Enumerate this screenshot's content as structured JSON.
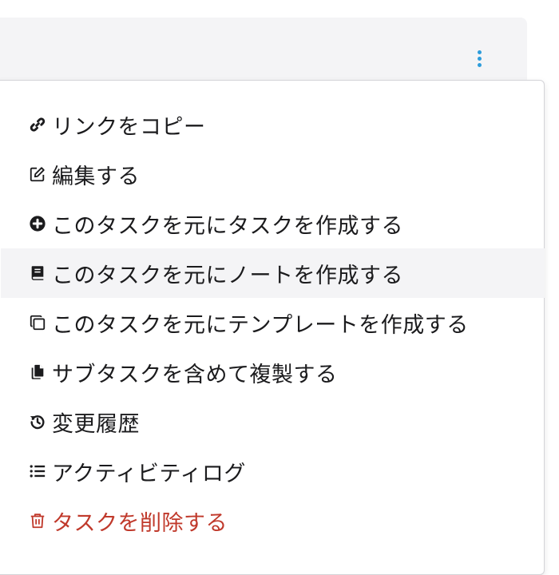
{
  "colors": {
    "accent": "#2d9cdb",
    "text": "#1b1b1d",
    "danger": "#c0392b",
    "highlight_bg": "#f4f4f6"
  },
  "header": {
    "more_icon": "vertical-ellipsis-icon"
  },
  "menu": {
    "items": [
      {
        "label": "リンクをコピー",
        "icon": "link-icon"
      },
      {
        "label": "編集する",
        "icon": "edit-icon"
      },
      {
        "label": "このタスクを元にタスクを作成する",
        "icon": "plus-circle-icon"
      },
      {
        "label": "このタスクを元にノートを作成する",
        "icon": "book-icon",
        "highlighted": true
      },
      {
        "label": "このタスクを元にテンプレートを作成する",
        "icon": "clone-icon"
      },
      {
        "label": "サブタスクを含めて複製する",
        "icon": "copy-icon"
      },
      {
        "label": "変更履歴",
        "icon": "history-icon"
      },
      {
        "label": "アクティビティログ",
        "icon": "list-icon"
      },
      {
        "label": "タスクを削除する",
        "icon": "trash-icon",
        "danger": true
      }
    ]
  }
}
